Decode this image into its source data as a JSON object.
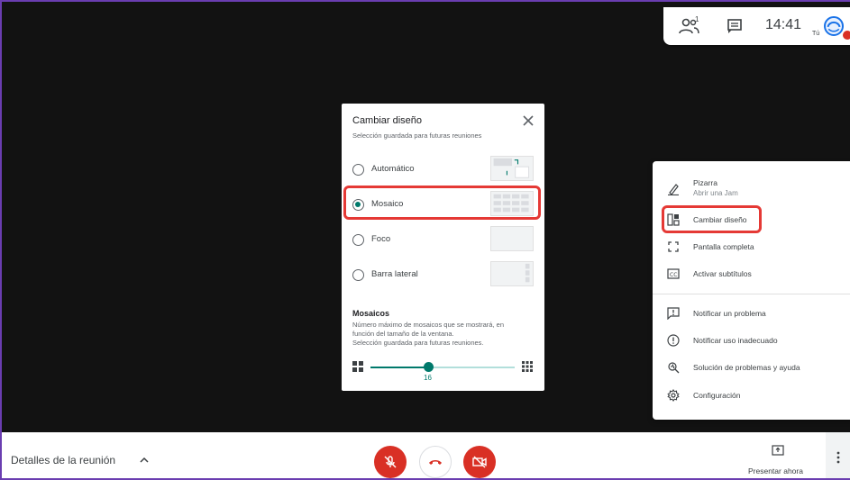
{
  "topbar": {
    "people_count": "1",
    "time": "14:41",
    "you_label": "Tú"
  },
  "layout_dialog": {
    "title": "Cambiar diseño",
    "subtitle": "Selección guardada para futuras reuniones",
    "options": [
      {
        "label": "Automático",
        "selected": false
      },
      {
        "label": "Mosaico",
        "selected": true
      },
      {
        "label": "Foco",
        "selected": false
      },
      {
        "label": "Barra lateral",
        "selected": false
      }
    ],
    "tiles_section": {
      "title": "Mosaicos",
      "description_line1": "Número máximo de mosaicos que se mostrará, en",
      "description_line2": "función del tamaño de la ventana.",
      "description_line3": "Selección guardada para futuras reuniones.",
      "slider_value": "16"
    }
  },
  "menu": {
    "items": [
      {
        "label": "Pizarra",
        "sublabel": "Abrir una Jam",
        "icon": "pencil-icon"
      },
      {
        "label": "Cambiar diseño",
        "icon": "layout-icon"
      },
      {
        "label": "Pantalla completa",
        "icon": "fullscreen-icon"
      },
      {
        "label": "Activar subtítulos",
        "icon": "captions-icon"
      },
      {
        "label": "Notificar un problema",
        "icon": "feedback-icon"
      },
      {
        "label": "Notificar uso inadecuado",
        "icon": "report-icon"
      },
      {
        "label": "Solución de problemas y ayuda",
        "icon": "troubleshoot-icon"
      },
      {
        "label": "Configuración",
        "icon": "settings-icon"
      }
    ]
  },
  "bottombar": {
    "details_label": "Detalles de la reunión",
    "present_label": "Presentar ahora"
  },
  "colors": {
    "accent_teal": "#00796b",
    "alert_red": "#d93025",
    "highlight_red": "#e53935"
  }
}
